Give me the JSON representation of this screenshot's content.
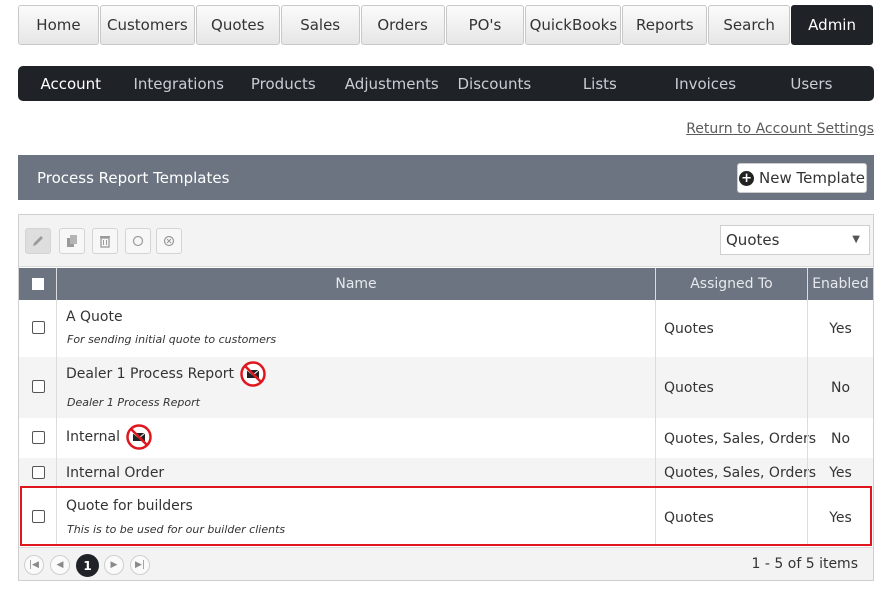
{
  "top_nav": [
    {
      "label": "Home",
      "active": false
    },
    {
      "label": "Customers",
      "active": false
    },
    {
      "label": "Quotes",
      "active": false
    },
    {
      "label": "Sales",
      "active": false
    },
    {
      "label": "Orders",
      "active": false
    },
    {
      "label": "PO's",
      "active": false
    },
    {
      "label": "QuickBooks",
      "active": false
    },
    {
      "label": "Reports",
      "active": false
    },
    {
      "label": "Search",
      "active": false
    },
    {
      "label": "Admin",
      "active": true
    }
  ],
  "sub_nav": [
    {
      "label": "Account",
      "active": true
    },
    {
      "label": "Integrations",
      "active": false
    },
    {
      "label": "Products",
      "active": false
    },
    {
      "label": "Adjustments",
      "active": false
    },
    {
      "label": "Discounts",
      "active": false
    },
    {
      "label": "Lists",
      "active": false
    },
    {
      "label": "Invoices",
      "active": false
    },
    {
      "label": "Users",
      "active": false
    }
  ],
  "return_link": "Return to Account Settings",
  "panel": {
    "title": "Process Report Templates",
    "new_button": "New Template"
  },
  "toolbar": {
    "icons": [
      "edit-icon",
      "copy-icon",
      "delete-icon",
      "circle-icon",
      "cancel-circle-icon"
    ],
    "filter_value": "Quotes"
  },
  "columns": {
    "name": "Name",
    "assigned": "Assigned To",
    "enabled": "Enabled"
  },
  "rows": [
    {
      "name": "A Quote",
      "description": "For sending initial quote to customers",
      "assigned": "Quotes",
      "enabled": "Yes",
      "no_email": false
    },
    {
      "name": "Dealer 1 Process Report",
      "description": "Dealer 1 Process Report",
      "assigned": "Quotes",
      "enabled": "No",
      "no_email": true
    },
    {
      "name": "Internal",
      "description": "",
      "assigned": "Quotes, Sales, Orders",
      "enabled": "No",
      "no_email": true
    },
    {
      "name": "Internal Order",
      "description": "",
      "assigned": "Quotes, Sales, Orders",
      "enabled": "Yes",
      "no_email": false
    },
    {
      "name": "Quote for builders",
      "description": "This is to be used for our builder clients",
      "assigned": "Quotes",
      "enabled": "Yes",
      "no_email": false
    }
  ],
  "pager": {
    "current_page": "1",
    "summary": "1 - 5 of 5 items"
  },
  "colors": {
    "dark_nav": "#1f2328",
    "header_gray": "#6b7480",
    "highlight_red": "#e0161e"
  }
}
